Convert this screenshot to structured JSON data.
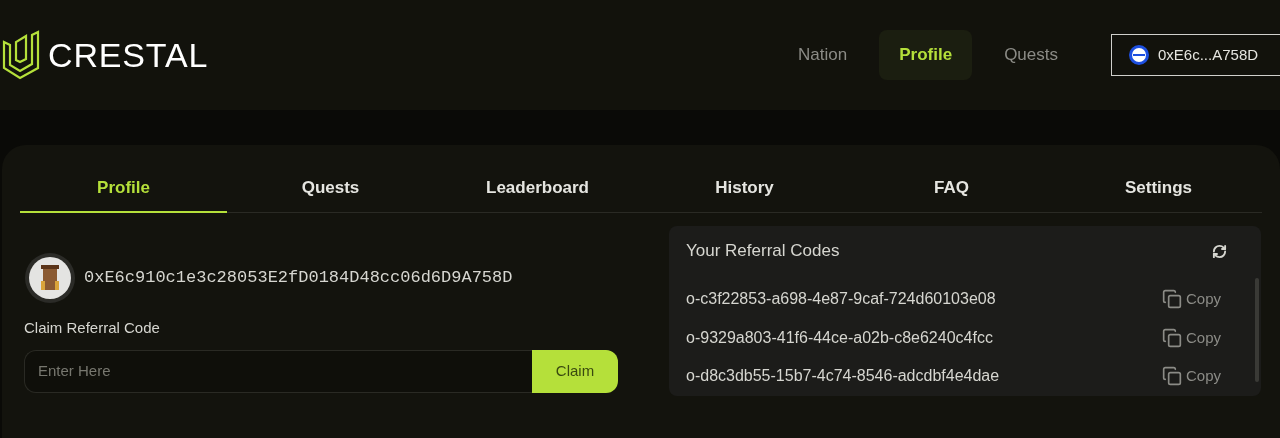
{
  "brand": {
    "name": "CRESTAL"
  },
  "nav": [
    {
      "label": "Nation",
      "selected": false
    },
    {
      "label": "Profile",
      "selected": true
    },
    {
      "label": "Quests",
      "selected": false
    }
  ],
  "wallet": {
    "address": "0xE6c...A758D"
  },
  "tabs": [
    {
      "label": "Profile",
      "selected": true
    },
    {
      "label": "Quests",
      "selected": false
    },
    {
      "label": "Leaderboard",
      "selected": false
    },
    {
      "label": "History",
      "selected": false
    },
    {
      "label": "FAQ",
      "selected": false
    },
    {
      "label": "Settings",
      "selected": false
    }
  ],
  "profile": {
    "address": "0xE6c910c1e3c28053E2fD0184D48cc06d6D9A758D",
    "claim_label": "Claim Referral Code",
    "claim_placeholder": "Enter Here",
    "claim_button": "Claim"
  },
  "referrals": {
    "title": "Your Referral Codes",
    "codes": [
      {
        "code": "o-c3f22853-a698-4e87-9caf-724d60103e08",
        "action": "Copy"
      },
      {
        "code": "o-9329a803-41f6-44ce-a02b-c8e6240c4fcc",
        "action": "Copy"
      },
      {
        "code": "o-d8c3db55-15b7-4c74-8546-adcdbf4e4dae",
        "action": "Copy"
      }
    ]
  }
}
